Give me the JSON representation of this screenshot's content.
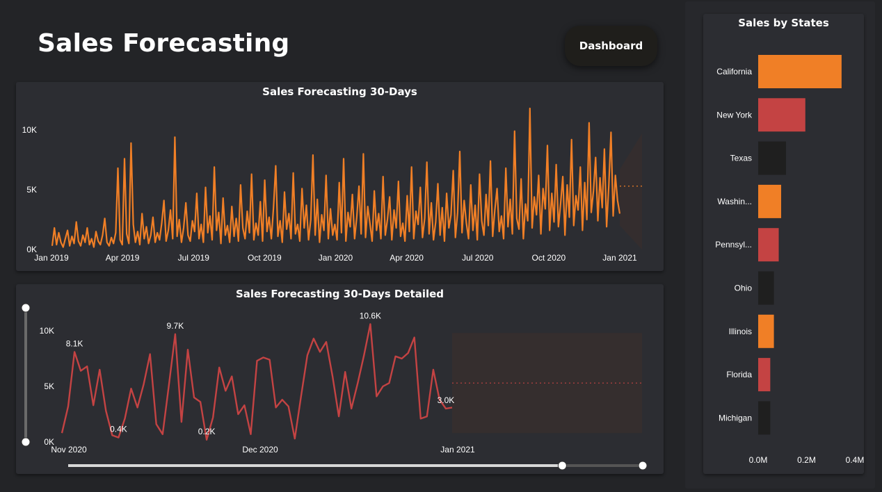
{
  "header": {
    "title": "Sales Forecasting",
    "dashboard_button": "Dashboard"
  },
  "colors": {
    "background": "#232427",
    "panel": "#2c2d32",
    "orange": "#f07f26",
    "red": "#c44343",
    "dark_bar": "#1f1f1f",
    "forecast_band": "#352e2e"
  },
  "chart_data": [
    {
      "type": "line",
      "title": "Sales Forecasting 30-Days",
      "xlabel": "",
      "ylabel": "",
      "x_ticks": [
        "Jan 2019",
        "Apr 2019",
        "Jul 2019",
        "Oct 2019",
        "Jan 2020",
        "Apr 2020",
        "Jul 2020",
        "Oct 2020",
        "Jan 2021"
      ],
      "y_ticks": [
        "0K",
        "5K",
        "10K"
      ],
      "ylim": [
        0,
        11000
      ],
      "grid": false,
      "series": [
        {
          "color": "#f07f26",
          "x_start": "2019-01-01",
          "values": [
            300,
            1800,
            400,
            1400,
            600,
            200,
            900,
            1600,
            300,
            1100,
            500,
            2300,
            700,
            300,
            1200,
            600,
            1800,
            400,
            900,
            200,
            1500,
            700,
            400,
            1200,
            2600,
            600,
            300,
            1000,
            500,
            1400,
            6800,
            800,
            400,
            7600,
            1300,
            500,
            8900,
            2100,
            600,
            1500,
            400,
            3000,
            900,
            1900,
            500,
            1200,
            2700,
            600,
            1400,
            800,
            2200,
            4100,
            700,
            1600,
            3300,
            900,
            9400,
            1100,
            2500,
            600,
            1800,
            3900,
            1200,
            700,
            2400,
            1500,
            4700,
            900,
            2100,
            600,
            5200,
            1400,
            2800,
            800,
            6900,
            1600,
            3100,
            500,
            4300,
            1200,
            2000,
            600,
            3600,
            1100,
            2600,
            700,
            5400,
            1800,
            900,
            3200,
            1400,
            6300,
            800,
            2200,
            1200,
            4000,
            700,
            5800,
            1500,
            2700,
            900,
            3500,
            7000,
            1100,
            2400,
            600,
            4800,
            1700,
            3000,
            900,
            6400,
            1300,
            2100,
            700,
            5100,
            1800,
            3700,
            800,
            2500,
            7900,
            1200,
            4200,
            600,
            2900,
            1600,
            6200,
            900,
            3400,
            1200,
            2100,
            800,
            5600,
            1400,
            7600,
            700,
            3100,
            1900,
            4600,
            900,
            2700,
            5300,
            1300,
            8000,
            1000,
            3600,
            2200,
            700,
            4900,
            1600,
            3000,
            900,
            6100,
            1200,
            2500,
            4400,
            800,
            3300,
            1800,
            5700,
            1100,
            2200,
            700,
            4500,
            1500,
            6900,
            900,
            3200,
            2100,
            5200,
            1000,
            2600,
            7300,
            1300,
            3900,
            800,
            2300,
            5500,
            1200,
            3500,
            700,
            4700,
            1800,
            2900,
            6600,
            1000,
            3100,
            8200,
            1400,
            4100,
            2200,
            900,
            5400,
            1600,
            3700,
            800,
            6300,
            2400,
            1200,
            4600,
            2000,
            7400,
            1100,
            3300,
            5100,
            1500,
            2800,
            900,
            6800,
            1900,
            4200,
            1300,
            9900,
            2600,
            1700,
            5900,
            900,
            3800,
            2400,
            11800,
            1800,
            4400,
            2900,
            6200,
            1300,
            5100,
            3400,
            8700,
            1600,
            4700,
            2300,
            7100,
            1900,
            3800,
            6100,
            1200,
            5400,
            2700,
            9200,
            2000,
            4500,
            3300,
            6900,
            1600,
            5600,
            2500,
            10600,
            3100,
            4900,
            7700,
            2400,
            6000,
            3500,
            8400,
            1900,
            5300,
            9800,
            2800,
            6200,
            4100,
            3000
          ],
          "forecast": {
            "mean": 5300,
            "upper": 9700,
            "lower": 800,
            "days": 30
          }
        }
      ]
    },
    {
      "type": "line",
      "title": "Sales Forecasting 30-Days Detailed",
      "xlabel": "",
      "ylabel": "",
      "x_ticks": [
        "Nov 2020",
        "Dec 2020",
        "Jan 2021"
      ],
      "y_ticks": [
        "0K",
        "5K",
        "10K"
      ],
      "ylim": [
        0,
        11000
      ],
      "grid": false,
      "series": [
        {
          "color": "#c44343",
          "x_start": "2020-11-01",
          "values": [
            800,
            3200,
            8100,
            6400,
            6800,
            3300,
            6500,
            2800,
            600,
            400,
            2100,
            4800,
            3100,
            5200,
            7900,
            1600,
            700,
            5100,
            9700,
            1800,
            8300,
            4000,
            3600,
            200,
            2200,
            6700,
            4600,
            5900,
            2500,
            3300,
            700,
            7300,
            7600,
            7400,
            3100,
            3800,
            3200,
            300,
            4100,
            7800,
            9300,
            8100,
            9000,
            5900,
            2300,
            6300,
            3000,
            5300,
            7800,
            10600,
            4100,
            5000,
            5300,
            7700,
            7500,
            8000,
            9400,
            2100,
            2300,
            6500,
            3800,
            3000,
            3100
          ],
          "data_labels": [
            {
              "index": 2,
              "text": "8.1K"
            },
            {
              "index": 9,
              "text": "0.4K"
            },
            {
              "index": 18,
              "text": "9.7K"
            },
            {
              "index": 23,
              "text": "0.2K"
            },
            {
              "index": 49,
              "text": "10.6K"
            },
            {
              "index": 61,
              "text": "3.0K"
            }
          ],
          "forecast": {
            "mean": 5300,
            "upper": 9800,
            "lower": 800,
            "days": 30
          }
        }
      ],
      "slider_x": {
        "start": 0,
        "end": 0.86
      },
      "slider_y": {
        "start": 0,
        "end": 1
      }
    },
    {
      "type": "bar",
      "orientation": "horizontal",
      "title": "Sales by States",
      "categories": [
        "California",
        "New York",
        "Texas",
        "Washin...",
        "Pennsyl...",
        "Ohio",
        "Illinois",
        "Florida",
        "Michigan"
      ],
      "values": [
        0.345,
        0.195,
        0.115,
        0.095,
        0.085,
        0.065,
        0.065,
        0.05,
        0.05
      ],
      "bar_colors": [
        "#f07f26",
        "#c44343",
        "#1f1f1f",
        "#f07f26",
        "#c44343",
        "#1f1f1f",
        "#f07f26",
        "#c44343",
        "#1f1f1f"
      ],
      "x_ticks": [
        "0.0M",
        "0.2M",
        "0.4M"
      ],
      "xlim": [
        0,
        0.4
      ],
      "unit": "M"
    }
  ]
}
